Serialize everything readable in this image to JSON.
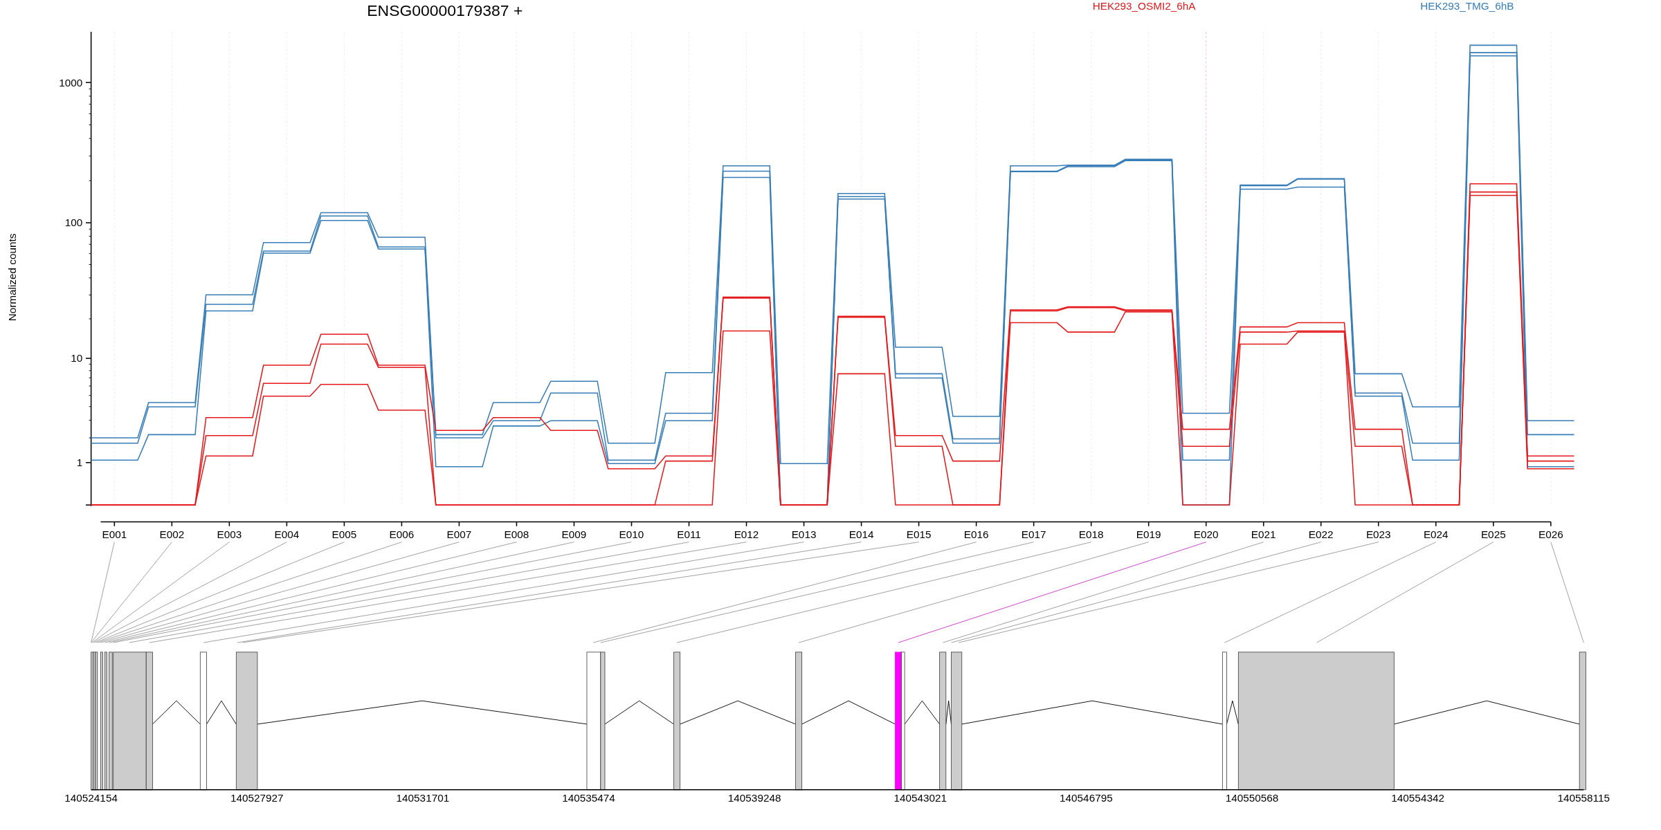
{
  "title": "ENSG00000179387 +",
  "conditions": [
    {
      "label": "HEK293_OSMI2_6hA",
      "color": "#e41a1c"
    },
    {
      "label": "HEK293_TMG_6hB",
      "color": "#377eb8"
    }
  ],
  "y_axis": {
    "label": "Normalized counts",
    "ticks": [
      "1000",
      "100",
      "10",
      "1"
    ]
  },
  "exon_labels": [
    "E001",
    "E002",
    "E003",
    "E004",
    "E005",
    "E006",
    "E007",
    "E008",
    "E009",
    "E010",
    "E011",
    "E012",
    "E013",
    "E014",
    "E015",
    "E016",
    "E017",
    "E018",
    "E019",
    "E020",
    "E021",
    "E022",
    "E023",
    "E024",
    "E025",
    "E026"
  ],
  "gene_model": {
    "boxes": [
      {
        "kind": "filled",
        "highlighted": false
      },
      {
        "kind": "filled",
        "highlighted": false
      },
      {
        "kind": "filled",
        "highlighted": false
      },
      {
        "kind": "filled",
        "highlighted": false
      },
      {
        "kind": "filled",
        "highlighted": false
      },
      {
        "kind": "filled",
        "highlighted": false
      },
      {
        "kind": "filled",
        "highlighted": false
      },
      {
        "kind": "filled",
        "highlighted": false
      },
      {
        "kind": "open",
        "highlighted": false
      },
      {
        "kind": "filled",
        "highlighted": false
      },
      {
        "kind": "open",
        "highlighted": false
      },
      {
        "kind": "filled",
        "highlighted": false
      },
      {
        "kind": "filled",
        "highlighted": false
      },
      {
        "kind": "filled",
        "highlighted": false
      },
      {
        "kind": "filled",
        "highlighted": true
      },
      {
        "kind": "open",
        "highlighted": false
      },
      {
        "kind": "filled",
        "highlighted": false
      },
      {
        "kind": "filled",
        "highlighted": false
      },
      {
        "kind": "open",
        "highlighted": false
      },
      {
        "kind": "filled",
        "highlighted": false
      },
      {
        "kind": "filled",
        "highlighted": false
      }
    ],
    "ticks": [
      "140524154",
      "140527927",
      "140531701",
      "140535474",
      "140539248",
      "140543021",
      "140546795",
      "140550568",
      "140554342",
      "140558115"
    ]
  }
}
